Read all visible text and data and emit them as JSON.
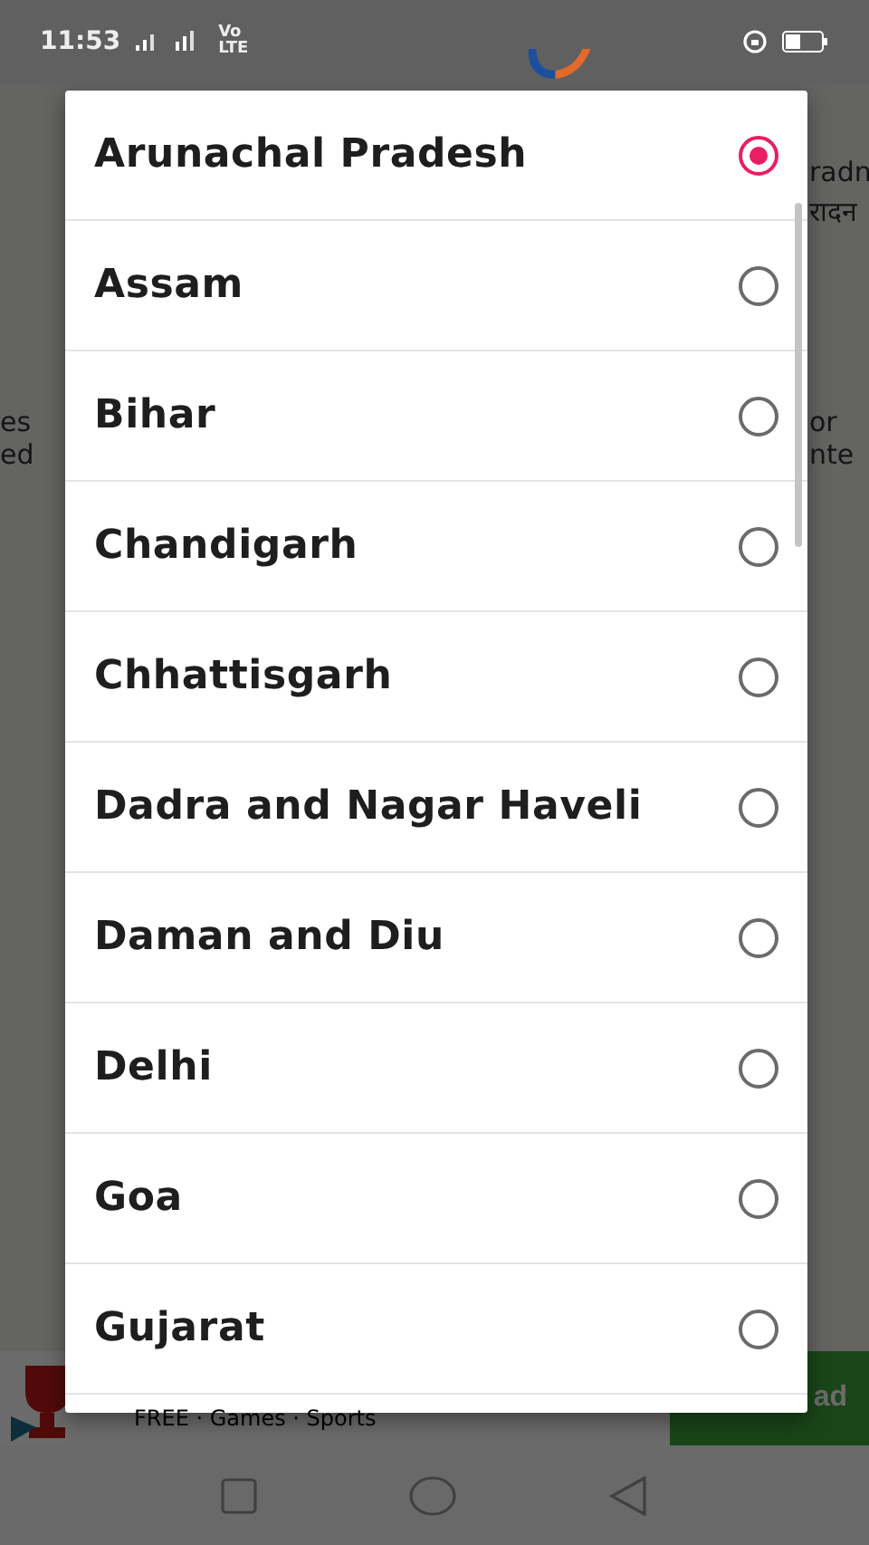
{
  "status_bar": {
    "time": "11:53",
    "network": "Vo LTE"
  },
  "background": {
    "texts": [
      "radn",
      "रादन",
      "es",
      "ed",
      "or",
      "nte"
    ]
  },
  "ad": {
    "text": "FREE · Games · Sports",
    "button": "ad"
  },
  "dialog": {
    "options": [
      {
        "label": "Arunachal Pradesh",
        "selected": true
      },
      {
        "label": "Assam",
        "selected": false
      },
      {
        "label": "Bihar",
        "selected": false
      },
      {
        "label": "Chandigarh",
        "selected": false
      },
      {
        "label": "Chhattisgarh",
        "selected": false
      },
      {
        "label": "Dadra and Nagar Haveli",
        "selected": false
      },
      {
        "label": "Daman and Diu",
        "selected": false
      },
      {
        "label": "Delhi",
        "selected": false
      },
      {
        "label": "Goa",
        "selected": false
      },
      {
        "label": "Gujarat",
        "selected": false
      }
    ]
  }
}
